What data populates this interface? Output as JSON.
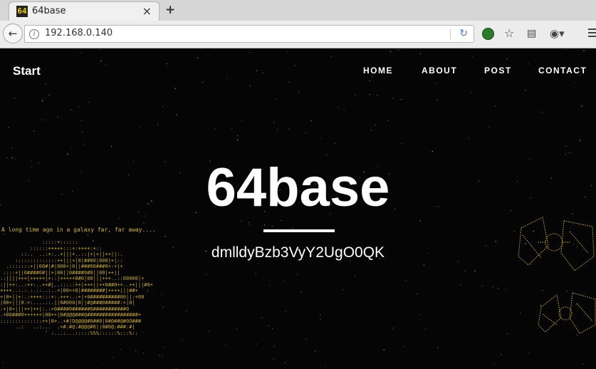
{
  "browser": {
    "tab": {
      "favicon": "64",
      "title": "64base",
      "close_glyph": "×"
    },
    "new_tab_glyph": "+",
    "back_glyph": "←",
    "url": "192.168.0.140",
    "icons": [
      "info-icon",
      "reload-icon",
      "extension-icon",
      "bookmark-star-icon",
      "reading-list-icon",
      "pocket-icon",
      "menu-icon"
    ]
  },
  "site": {
    "brand": "Start",
    "nav": [
      "HOME",
      "ABOUT",
      "POST",
      "CONTACT"
    ],
    "hero_title": "64base",
    "hero_subtitle": "dmlldyBzb3VyY2UgO0QK",
    "ascii_caption": "A long time ago in a galaxy far, far away...."
  },
  "colors": {
    "accent": "#d4b44a",
    "background": "#050505",
    "text": "#ffffff"
  }
}
